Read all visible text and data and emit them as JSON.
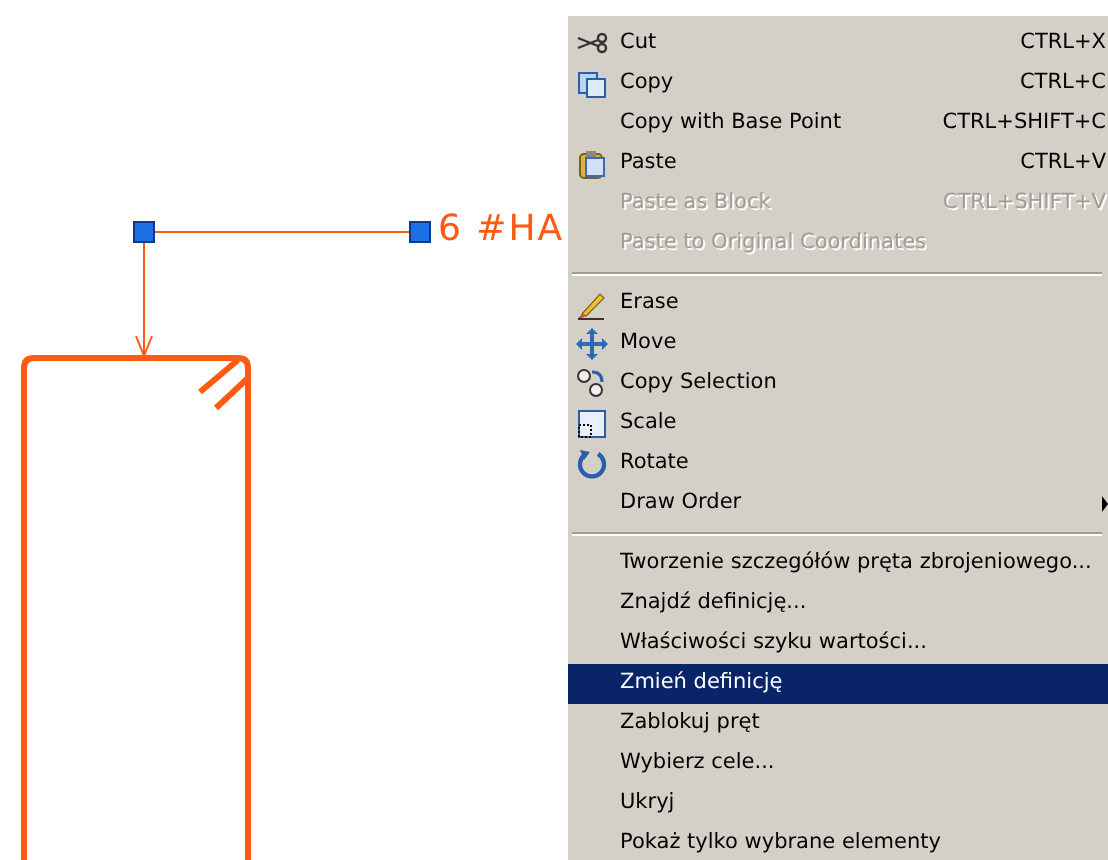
{
  "drawing": {
    "label": "6 #HA"
  },
  "context_menu": {
    "groups": [
      [
        {
          "label": "Cut",
          "shortcut": "CTRL+X",
          "disabled": false,
          "selected": false,
          "submenu": false
        },
        {
          "label": "Copy",
          "shortcut": "CTRL+C",
          "disabled": false,
          "selected": false,
          "submenu": false
        },
        {
          "label": "Copy with Base Point",
          "shortcut": "CTRL+SHIFT+C",
          "disabled": false,
          "selected": false,
          "submenu": false
        },
        {
          "label": "Paste",
          "shortcut": "CTRL+V",
          "disabled": false,
          "selected": false,
          "submenu": false
        },
        {
          "label": "Paste as Block",
          "shortcut": "CTRL+SHIFT+V",
          "disabled": true,
          "selected": false,
          "submenu": false
        },
        {
          "label": "Paste to Original Coordinates",
          "disabled": true,
          "selected": false,
          "submenu": false
        }
      ],
      [
        {
          "label": "Erase",
          "disabled": false,
          "selected": false,
          "submenu": false
        },
        {
          "label": "Move",
          "disabled": false,
          "selected": false,
          "submenu": false
        },
        {
          "label": "Copy Selection",
          "disabled": false,
          "selected": false,
          "submenu": false
        },
        {
          "label": "Scale",
          "disabled": false,
          "selected": false,
          "submenu": false
        },
        {
          "label": "Rotate",
          "disabled": false,
          "selected": false,
          "submenu": false
        },
        {
          "label": "Draw Order",
          "disabled": false,
          "selected": false,
          "submenu": true
        }
      ],
      [
        {
          "label": "Tworzenie szczegółów pręta zbrojeniowego...",
          "disabled": false,
          "selected": false,
          "submenu": false
        },
        {
          "label": "Znajdź definicję...",
          "disabled": false,
          "selected": false,
          "submenu": false
        },
        {
          "label": "Właściwości szyku wartości...",
          "disabled": false,
          "selected": false,
          "submenu": false
        },
        {
          "label": "Zmień definicję",
          "disabled": false,
          "selected": true,
          "submenu": false
        },
        {
          "label": "Zablokuj pręt",
          "disabled": false,
          "selected": false,
          "submenu": false
        },
        {
          "label": "Wybierz cele...",
          "disabled": false,
          "selected": false,
          "submenu": false
        },
        {
          "label": "Ukryj",
          "disabled": false,
          "selected": false,
          "submenu": false
        },
        {
          "label": "Pokaż tylko wybrane elementy",
          "disabled": false,
          "selected": false,
          "submenu": false
        }
      ]
    ]
  }
}
